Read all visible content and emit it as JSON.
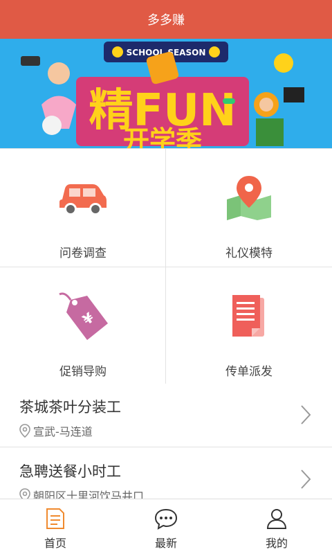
{
  "header": {
    "title": "多多赚"
  },
  "banner": {
    "top_text": "SCHOOL SEASON",
    "big_text": "精FUN",
    "sub_text": "开学季"
  },
  "categories": [
    {
      "label": "问卷调查",
      "icon": "car-icon"
    },
    {
      "label": "礼仪模特",
      "icon": "map-pin-icon"
    },
    {
      "label": "促销导购",
      "icon": "price-tag-icon"
    },
    {
      "label": "传单派发",
      "icon": "document-icon"
    }
  ],
  "jobs": [
    {
      "title": "茶城茶叶分装工",
      "location": "宣武-马连道"
    },
    {
      "title": "急聘送餐小时工",
      "location": "朝阳区十里河饮马井口"
    }
  ],
  "tabs": [
    {
      "label": "首页",
      "icon": "home-doc-icon",
      "active": true
    },
    {
      "label": "最新",
      "icon": "chat-bubble-icon",
      "active": false
    },
    {
      "label": "我的",
      "icon": "user-icon",
      "active": false
    }
  ],
  "colors": {
    "header_bg": "#e05a45",
    "car": "#f26b4f",
    "pin": "#f0654a",
    "map": "#8fd18c",
    "tag": "#c66aa1",
    "doc": "#ef5f5a",
    "active_tab": "#f08a2e"
  }
}
